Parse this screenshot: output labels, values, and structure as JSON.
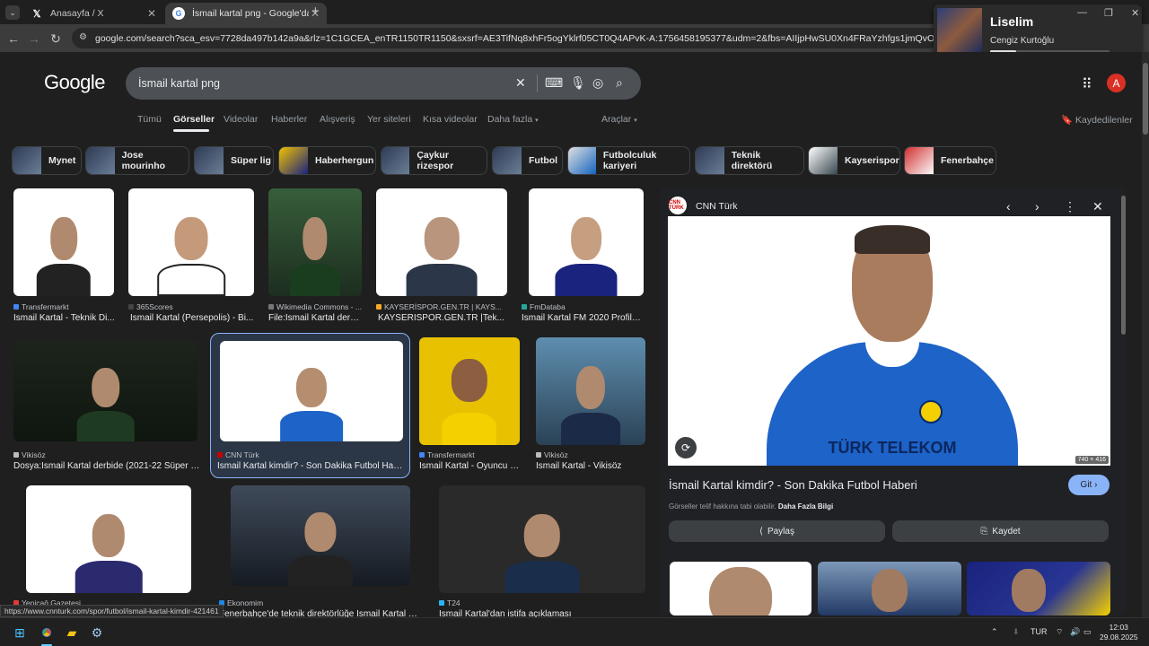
{
  "browser": {
    "tabs": [
      {
        "title": "Anasayfa / X",
        "active": false
      },
      {
        "title": "İsmail kartal png - Google'da A",
        "active": true
      }
    ],
    "new_tab": "+",
    "url": "google.com/search?sca_esv=7728da497b142a9a&rlz=1C1GCEA_enTR1150TR1150&sxsrf=AE3TifNq8xhFr5ogYklrf05CT0Q4APvK-A:1756458195377&udm=2&fbs=AIIjpHwSU0Xn4FRaYzhfgs1jmQvOnw1dDD9iiBulB2fsjeHv6Rzi_t..."
  },
  "media": {
    "title": "Liselim",
    "artist": "Cengiz Kurtoğlu",
    "progress": 0.22
  },
  "google": {
    "logo": "Google",
    "query": "İsmail kartal png",
    "nav_tabs": [
      "Tümü",
      "Görseller",
      "Videolar",
      "Haberler",
      "Alışveriş",
      "Yer siteleri",
      "Kısa videolar",
      "Daha fazla",
      "Araçlar"
    ],
    "selected_tab": "Görseller",
    "saved": "Kaydedilenler",
    "avatar": "A"
  },
  "chips": [
    "Mynet",
    "Jose mourinho",
    "Süper lig",
    "Haberhergun",
    "Çaykur rizespor",
    "Futbol",
    "Futbolculuk kariyeri",
    "Teknik direktörü",
    "Kayserispor",
    "Fenerbahçe"
  ],
  "results": [
    {
      "source": "Transfermarkt",
      "caption": "İsmail Kartal - Teknik Di..."
    },
    {
      "source": "365Scores",
      "caption": "İsmail Kartal (Persepolis) - Bi..."
    },
    {
      "source": "Wikimedia Commons - ...",
      "caption": "File:İsmail Kartal derb..."
    },
    {
      "source": "KAYSERİSPOR.GEN.TR | KAYS...",
      "caption": "KAYSERİSPOR.GEN.TR |Tek..."
    },
    {
      "source": "FmDataba",
      "caption": "İsmail Kartal FM 2020 Profile..."
    },
    {
      "source": "Vikisöz",
      "caption": "Dosya:İsmail Kartal derbide (2021-22 Süper Li..."
    },
    {
      "source": "CNN Türk",
      "caption": "İsmail Kartal kimdir? - Son Dakika Futbol Haberi"
    },
    {
      "source": "Transfermarkt",
      "caption": "İsmail Kartal - Oyuncu p..."
    },
    {
      "source": "Vikisöz",
      "caption": "İsmail Kartal - Vikisöz"
    },
    {
      "source": "Yeniçağ Gazetesi",
      "caption": ""
    },
    {
      "source": "Ekonomim",
      "caption": "Fenerbahçe'de teknik direktörlüğe İsmail Kartal get..."
    },
    {
      "source": "T24",
      "caption": "İsmail Kartal'dan istifa açıklaması"
    }
  ],
  "preview": {
    "source": "CNN Türk",
    "logo_text": "CNN TÜRK",
    "dimensions": "740 × 416",
    "title": "İsmail Kartal kimdir? - Son Dakika Futbol Haberi",
    "visit": "Git",
    "note": "Görseller telif hakkına tabi olabilir.",
    "note_link": "Daha Fazla Bilgi",
    "share": "Paylaş",
    "save": "Kaydet",
    "jersey_text": "TÜRK TELEKOM"
  },
  "status_url": "https://www.cnnturk.com/spor/futbol/ismail-kartal-kimdir-421461",
  "taskbar": {
    "lang": "TUR",
    "time": "12:03",
    "date": "29.08.2025"
  }
}
